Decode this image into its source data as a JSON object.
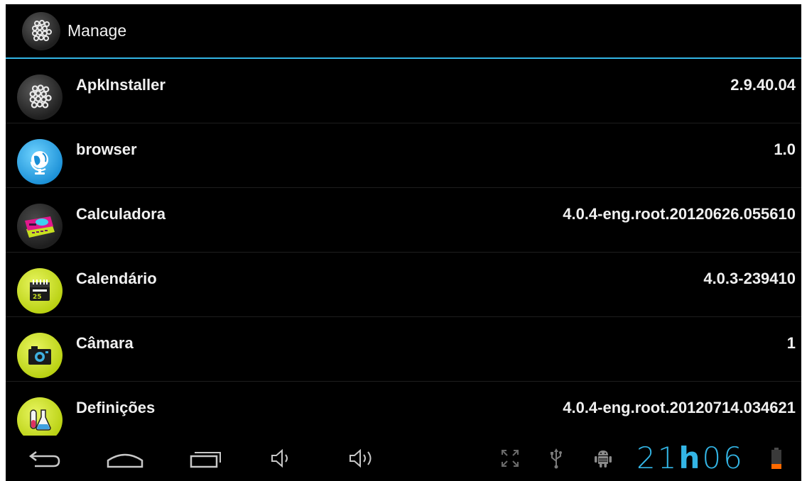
{
  "action_bar": {
    "title": "Manage",
    "icon": "apkinstaller-icon"
  },
  "apps": [
    {
      "name": "ApkInstaller",
      "version": "2.9.40.04",
      "icon": "apkinstaller-icon"
    },
    {
      "name": "browser",
      "version": "1.0",
      "icon": "browser-globe-icon"
    },
    {
      "name": "Calculadora",
      "version": "4.0.4-eng.root.20120626.055610",
      "icon": "calculator-icon"
    },
    {
      "name": "Calendário",
      "version": "4.0.3-239410",
      "icon": "calendar-icon"
    },
    {
      "name": "Câmara",
      "version": "1",
      "icon": "camera-icon"
    },
    {
      "name": "Definições",
      "version": "4.0.4-eng.root.20120714.034621",
      "icon": "settings-flask-icon"
    }
  ],
  "nav_bar": {
    "buttons": [
      "back-icon",
      "home-icon",
      "recent-apps-icon",
      "volume-down-icon",
      "volume-up-icon"
    ],
    "status_icons": [
      "fullscreen-icon",
      "usb-icon",
      "android-debug-icon",
      "battery-icon"
    ],
    "clock_hours": "21",
    "clock_separator": "h",
    "clock_minutes": "06"
  },
  "colors": {
    "accent": "#33b5e5",
    "battery_level": "#ff6a00",
    "background": "#000000"
  }
}
